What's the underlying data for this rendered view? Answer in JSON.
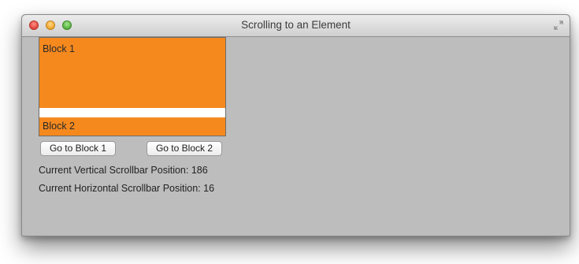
{
  "window": {
    "title": "Scrolling to an Element"
  },
  "scroll_pane": {
    "block1_label": "Block 1",
    "block2_label": "Block 2",
    "block_color": "#f5891e",
    "gap_color": "#ffffff"
  },
  "buttons": {
    "go_block1": "Go to Block 1",
    "go_block2": "Go to Block 2"
  },
  "status": {
    "vertical_label": "Current Vertical Scrollbar Position: 186",
    "horizontal_label": "Current Horizontal Scrollbar Position: 16"
  },
  "icons": {
    "close": "close-icon",
    "minimize": "minimize-icon",
    "zoom": "zoom-icon",
    "fullscreen": "fullscreen-icon"
  }
}
